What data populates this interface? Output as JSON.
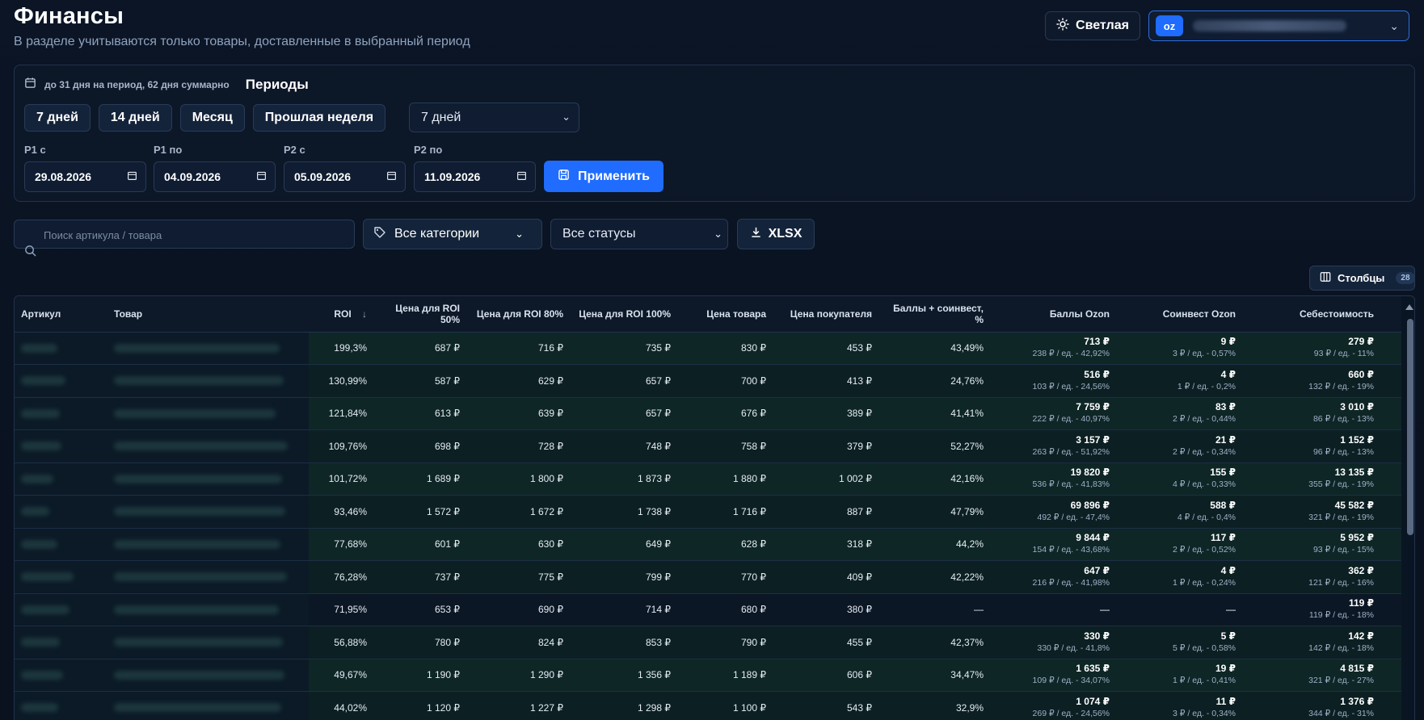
{
  "header": {
    "title": "Финансы",
    "subtitle": "В разделе учитываются только товары, доставленные в выбранный период",
    "theme_label": "Светлая",
    "store_badge": "oz"
  },
  "periods": {
    "hint": "до 31 дня на период, 62 дня суммарно",
    "title": "Периоды",
    "presets": [
      "7 дней",
      "14 дней",
      "Месяц",
      "Прошлая неделя"
    ],
    "preset_select_value": "7 дней",
    "p1_from_label": "P1 с",
    "p1_from_value": "29.08.2026",
    "p1_to_label": "P1 по",
    "p1_to_value": "04.09.2026",
    "p2_from_label": "P2 с",
    "p2_from_value": "05.09.2026",
    "p2_to_label": "P2 по",
    "p2_to_value": "11.09.2026",
    "apply_label": "Применить"
  },
  "filters": {
    "search_placeholder": "Поиск артикула / товара",
    "category_value": "Все категории",
    "status_value": "Все статусы",
    "export_label": "XLSX",
    "columns_label": "Столбцы",
    "columns_count": "28"
  },
  "table": {
    "headers": {
      "sku": "Артикул",
      "product": "Товар",
      "roi": "ROI",
      "roi_sort": "↓",
      "price_roi_50": "Цена для ROI 50%",
      "price_roi_80": "Цена для ROI 80%",
      "price_roi_100": "Цена для ROI 100%",
      "price": "Цена товара",
      "buyer_price": "Цена покупателя",
      "points_coinvest": "Баллы + соинвест, %",
      "ozon_points": "Баллы Ozon",
      "ozon_coinvest": "Соинвест Ozon",
      "cost": "Себестоимость"
    },
    "rows": [
      {
        "roi": "199,3%",
        "p50": "687 ₽",
        "p80": "716 ₽",
        "p100": "735 ₽",
        "price": "830 ₽",
        "buyer": "453 ₽",
        "pc": "43,49%",
        "pts": "713 ₽",
        "pts_sub": "238 ₽ / ед. - 42,92%",
        "co": "9 ₽",
        "co_sub": "3 ₽ / ед. - 0,57%",
        "cost": "279 ₽",
        "cost_sub": "93 ₽ / ед. - 11%"
      },
      {
        "roi": "130,99%",
        "p50": "587 ₽",
        "p80": "629 ₽",
        "p100": "657 ₽",
        "price": "700 ₽",
        "buyer": "413 ₽",
        "pc": "24,76%",
        "pts": "516 ₽",
        "pts_sub": "103 ₽ / ед. - 24,56%",
        "co": "4 ₽",
        "co_sub": "1 ₽ / ед. - 0,2%",
        "cost": "660 ₽",
        "cost_sub": "132 ₽ / ед. - 19%"
      },
      {
        "roi": "121,84%",
        "p50": "613 ₽",
        "p80": "639 ₽",
        "p100": "657 ₽",
        "price": "676 ₽",
        "buyer": "389 ₽",
        "pc": "41,41%",
        "pts": "7 759 ₽",
        "pts_sub": "222 ₽ / ед. - 40,97%",
        "co": "83 ₽",
        "co_sub": "2 ₽ / ед. - 0,44%",
        "cost": "3 010 ₽",
        "cost_sub": "86 ₽ / ед. - 13%"
      },
      {
        "roi": "109,76%",
        "p50": "698 ₽",
        "p80": "728 ₽",
        "p100": "748 ₽",
        "price": "758 ₽",
        "buyer": "379 ₽",
        "pc": "52,27%",
        "pts": "3 157 ₽",
        "pts_sub": "263 ₽ / ед. - 51,92%",
        "co": "21 ₽",
        "co_sub": "2 ₽ / ед. - 0,34%",
        "cost": "1 152 ₽",
        "cost_sub": "96 ₽ / ед. - 13%"
      },
      {
        "roi": "101,72%",
        "p50": "1 689 ₽",
        "p80": "1 800 ₽",
        "p100": "1 873 ₽",
        "price": "1 880 ₽",
        "buyer": "1 002 ₽",
        "pc": "42,16%",
        "pts": "19 820 ₽",
        "pts_sub": "536 ₽ / ед. - 41,83%",
        "co": "155 ₽",
        "co_sub": "4 ₽ / ед. - 0,33%",
        "cost": "13 135 ₽",
        "cost_sub": "355 ₽ / ед. - 19%"
      },
      {
        "roi": "93,46%",
        "p50": "1 572 ₽",
        "p80": "1 672 ₽",
        "p100": "1 738 ₽",
        "price": "1 716 ₽",
        "buyer": "887 ₽",
        "pc": "47,79%",
        "pts": "69 896 ₽",
        "pts_sub": "492 ₽ / ед. - 47,4%",
        "co": "588 ₽",
        "co_sub": "4 ₽ / ед. - 0,4%",
        "cost": "45 582 ₽",
        "cost_sub": "321 ₽ / ед. - 19%"
      },
      {
        "roi": "77,68%",
        "p50": "601 ₽",
        "p80": "630 ₽",
        "p100": "649 ₽",
        "price": "628 ₽",
        "buyer": "318 ₽",
        "pc": "44,2%",
        "pts": "9 844 ₽",
        "pts_sub": "154 ₽ / ед. - 43,68%",
        "co": "117 ₽",
        "co_sub": "2 ₽ / ед. - 0,52%",
        "cost": "5 952 ₽",
        "cost_sub": "93 ₽ / ед. - 15%"
      },
      {
        "roi": "76,28%",
        "p50": "737 ₽",
        "p80": "775 ₽",
        "p100": "799 ₽",
        "price": "770 ₽",
        "buyer": "409 ₽",
        "pc": "42,22%",
        "pts": "647 ₽",
        "pts_sub": "216 ₽ / ед. - 41,98%",
        "co": "4 ₽",
        "co_sub": "1 ₽ / ед. - 0,24%",
        "cost": "362 ₽",
        "cost_sub": "121 ₽ / ед. - 16%"
      },
      {
        "roi": "71,95%",
        "p50": "653 ₽",
        "p80": "690 ₽",
        "p100": "714 ₽",
        "price": "680 ₽",
        "buyer": "380 ₽",
        "pc": "—",
        "pts": "—",
        "pts_sub": "",
        "co": "—",
        "co_sub": "",
        "cost": "119 ₽",
        "cost_sub": "119 ₽ / ед. - 18%"
      },
      {
        "roi": "56,88%",
        "p50": "780 ₽",
        "p80": "824 ₽",
        "p100": "853 ₽",
        "price": "790 ₽",
        "buyer": "455 ₽",
        "pc": "42,37%",
        "pts": "330 ₽",
        "pts_sub": "330 ₽ / ед. - 41,8%",
        "co": "5 ₽",
        "co_sub": "5 ₽ / ед. - 0,58%",
        "cost": "142 ₽",
        "cost_sub": "142 ₽ / ед. - 18%"
      },
      {
        "roi": "49,67%",
        "p50": "1 190 ₽",
        "p80": "1 290 ₽",
        "p100": "1 356 ₽",
        "price": "1 189 ₽",
        "buyer": "606 ₽",
        "pc": "34,47%",
        "pts": "1 635 ₽",
        "pts_sub": "109 ₽ / ед. - 34,07%",
        "co": "19 ₽",
        "co_sub": "1 ₽ / ед. - 0,41%",
        "cost": "4 815 ₽",
        "cost_sub": "321 ₽ / ед. - 27%"
      },
      {
        "roi": "44,02%",
        "p50": "1 120 ₽",
        "p80": "1 227 ₽",
        "p100": "1 298 ₽",
        "price": "1 100 ₽",
        "buyer": "543 ₽",
        "pc": "32,9%",
        "pts": "1 074 ₽",
        "pts_sub": "269 ₽ / ед. - 24,56%",
        "co": "11 ₽",
        "co_sub": "3 ₽ / ед. - 0,34%",
        "cost": "1 376 ₽",
        "cost_sub": "344 ₽ / ед. - 31%"
      }
    ]
  }
}
